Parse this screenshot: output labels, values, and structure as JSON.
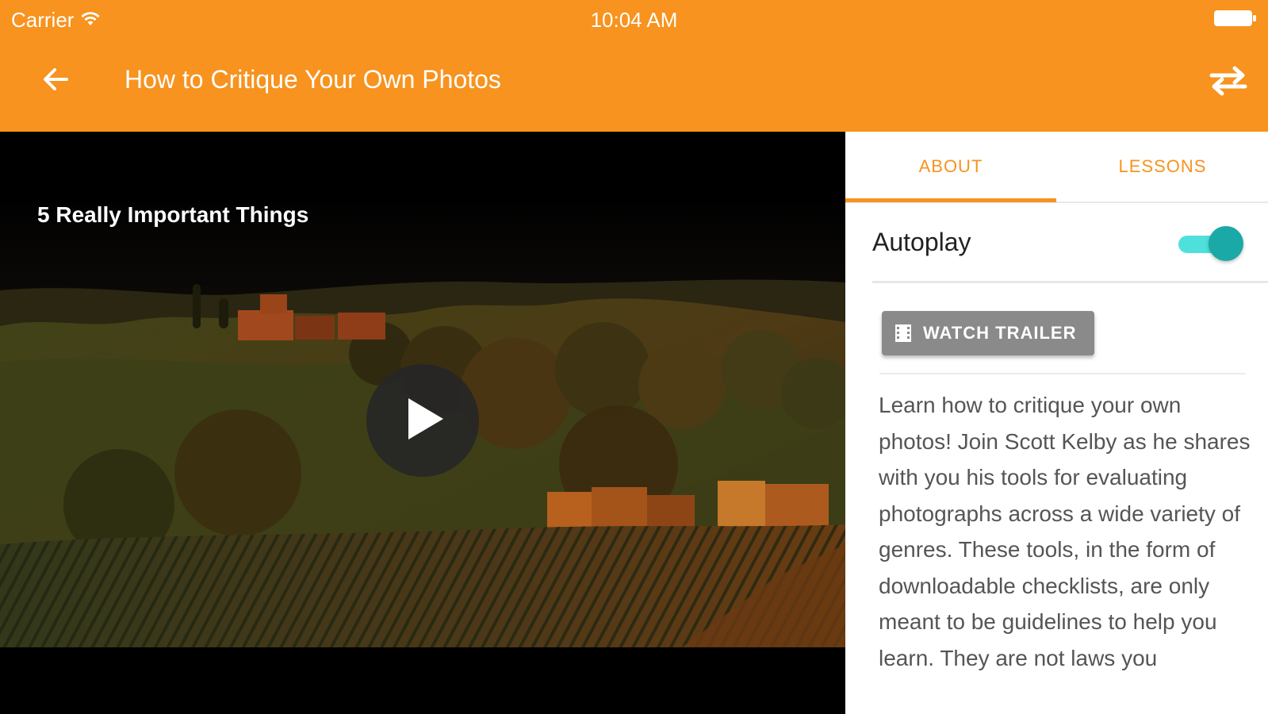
{
  "status_bar": {
    "carrier": "Carrier",
    "time": "10:04 AM"
  },
  "header": {
    "title": "How to Critique Your Own Photos",
    "back_icon": "arrow-left-icon",
    "swap_icon": "swap-arrows-icon",
    "background": "#f7931e"
  },
  "video": {
    "caption": "5 Really Important Things",
    "play_icon": "play-icon"
  },
  "tabs": [
    {
      "label": "ABOUT",
      "selected": true
    },
    {
      "label": "LESSONS",
      "selected": false
    }
  ],
  "about": {
    "autoplay_label": "Autoplay",
    "autoplay_on": true,
    "trailer_button": "WATCH TRAILER",
    "description": "Learn how to critique your own photos! Join Scott Kelby as he shares with you his tools for evaluating photographs across a wide variety of genres. These tools, in the form of downloadable checklists, are only meant to be guidelines to help you learn. They are not laws you"
  },
  "colors": {
    "accent": "#f7931e",
    "toggle_track": "#4fe0dc",
    "toggle_thumb": "#1aa9a7",
    "button_gray": "#8a8a8a"
  }
}
